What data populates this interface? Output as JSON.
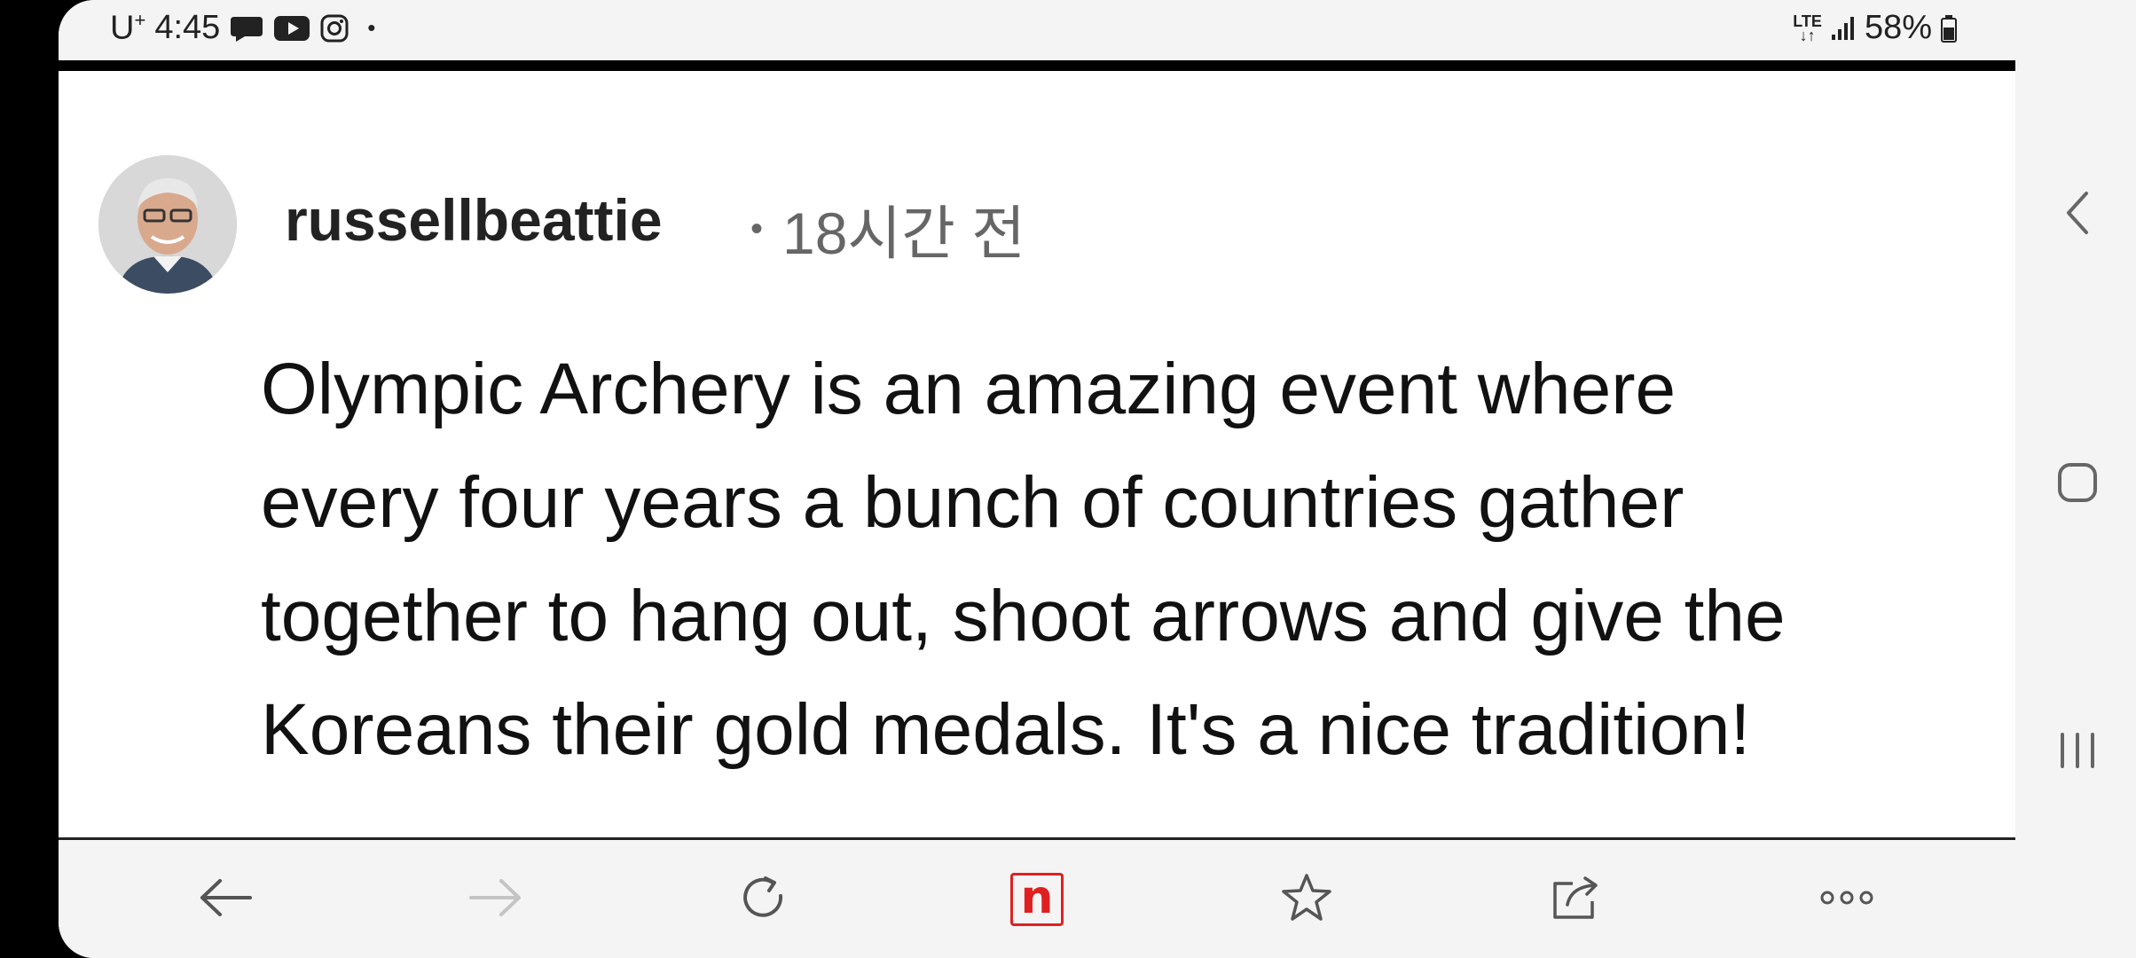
{
  "status_bar": {
    "carrier": "U",
    "carrier_sup": "+",
    "time": "4:45",
    "network": "LTE",
    "battery": "58%"
  },
  "post": {
    "username": "russellbeattie",
    "timestamp": "18시간 전",
    "comment_lines": [
      "Olympic Archery is an amazing event where",
      "every four years a bunch of countries gather",
      "together to hang out, shoot arrows and give the",
      "Koreans their gold medals. It's a nice tradition!"
    ]
  },
  "toolbar": {
    "icons": [
      "back-arrow-icon",
      "forward-arrow-icon",
      "reload-icon",
      "naver-n-icon",
      "star-icon",
      "share-icon",
      "more-icon"
    ],
    "naver_letter": "n",
    "accent_color": "#e02020",
    "forward_disabled": true
  },
  "system_nav": {
    "icons": [
      "back-chevron-icon",
      "home-icon",
      "recents-icon"
    ]
  }
}
